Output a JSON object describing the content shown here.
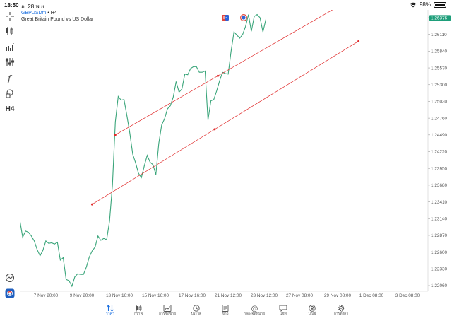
{
  "status_bar": {
    "time": "18:50",
    "date": "อ. 28 พ.ย.",
    "battery": "98%",
    "battery_level": 0.98
  },
  "toolbar": {
    "items": [
      {
        "name": "crosshair-icon"
      },
      {
        "name": "indicators-icon"
      },
      {
        "name": "volume-bars-icon"
      },
      {
        "name": "settings-sliders-icon"
      },
      {
        "name": "function-icon"
      },
      {
        "name": "shapes-icon"
      },
      {
        "name": "timeframe",
        "label": "H4"
      }
    ],
    "bottom_icons": [
      "crosshair-target-icon",
      "mt5-app-icon"
    ]
  },
  "chart_header": {
    "symbol": "GBPUSDm",
    "separator": " • ",
    "timeframe": "H4",
    "description": "Great Britain Pound vs US Dollar",
    "current_price": "1.26376",
    "colors": {
      "accent": "#1a6fe0",
      "line": "#3aa57a",
      "channel": "#e02b2b",
      "price_badge": "#1e9e7a"
    }
  },
  "chart_data": {
    "type": "line",
    "y_ticks": [
      "1.26380",
      "1.26110",
      "1.25840",
      "1.25570",
      "1.25300",
      "1.25030",
      "1.24760",
      "1.24490",
      "1.24220",
      "1.23950",
      "1.23680",
      "1.23410",
      "1.23140",
      "1.22870",
      "1.22600",
      "1.22330",
      "1.22060"
    ],
    "x_ticks": [
      "7 Nov 20:00",
      "9 Nov 20:00",
      "13 Nov 16:00",
      "15 Nov 16:00",
      "17 Nov 16:00",
      "21 Nov 12:00",
      "23 Nov 12:00",
      "27 Nov 08:00",
      "29 Nov 08:00",
      "1 Dec 08:00",
      "3 Dec 08:00"
    ],
    "ylim": [
      1.219,
      1.2652
    ],
    "series": [
      {
        "values": [
          1.2312,
          1.2284,
          1.2294,
          1.2292,
          1.2286,
          1.2278,
          1.2264,
          1.2254,
          1.2263,
          1.2278,
          1.2274,
          1.2275,
          1.2273,
          1.2276,
          1.2247,
          1.2251,
          1.2216,
          1.2214,
          1.2205,
          1.222,
          1.2225,
          1.2224,
          1.2224,
          1.2236,
          1.2252,
          1.2262,
          1.2268,
          1.2286,
          1.2279,
          1.2282,
          1.228,
          1.231,
          1.2368,
          1.247,
          1.2511,
          1.2505,
          1.2506,
          1.248,
          1.2452,
          1.2418,
          1.2404,
          1.2387,
          1.238,
          1.2399,
          1.2416,
          1.2405,
          1.2401,
          1.2385,
          1.2435,
          1.2465,
          1.2475,
          1.2491,
          1.2496,
          1.251,
          1.2535,
          1.2518,
          1.2523,
          1.2547,
          1.2546,
          1.2556,
          1.2559,
          1.2559,
          1.255,
          1.255,
          1.2552,
          1.2473,
          1.2504,
          1.2506,
          1.252,
          1.2536,
          1.255,
          1.2548,
          1.2547,
          1.2584,
          1.2615,
          1.261,
          1.2605,
          1.2611,
          1.2624,
          1.2643,
          1.2616,
          1.264,
          1.2643,
          1.2638,
          1.2615,
          1.2635
        ]
      }
    ],
    "channel_upper": {
      "start": [
        33,
        1.2449
      ],
      "end": [
        110,
        1.2656
      ]
    },
    "channel_lower": {
      "start": [
        25,
        1.2337
      ],
      "end": [
        117,
        1.26
      ]
    },
    "grid": false,
    "current_price": 1.26376
  },
  "bottom_nav": {
    "items": [
      {
        "label": "ราคา",
        "icon": "arrows-updown-icon",
        "active": true
      },
      {
        "label": "กราฟ",
        "icon": "candles-icon",
        "active": false
      },
      {
        "label": "การซื้อขาย",
        "icon": "trade-chart-icon",
        "active": false
      },
      {
        "label": "ประวัติ",
        "icon": "history-icon",
        "active": false
      },
      {
        "label": "ข่าว",
        "icon": "news-icon",
        "active": false
      },
      {
        "label": "กล่องจดหมาย",
        "icon": "mail-at-icon",
        "active": false
      },
      {
        "label": "แชท",
        "icon": "chat-icon",
        "active": false
      },
      {
        "label": "บัญชี",
        "icon": "account-icon",
        "active": false
      },
      {
        "label": "การตั้งค่า",
        "icon": "settings-gear-icon",
        "active": false
      }
    ]
  }
}
